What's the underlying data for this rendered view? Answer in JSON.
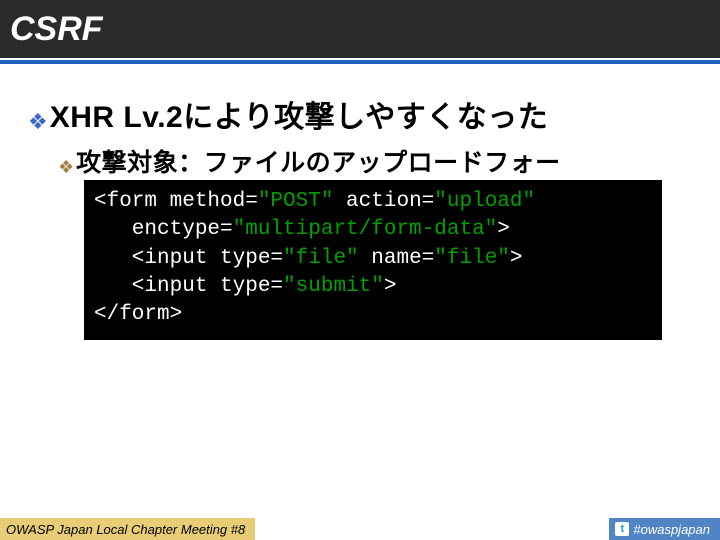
{
  "header": {
    "title": "CSRF"
  },
  "content": {
    "heading": "XHR Lv.2により攻撃しやすくなった",
    "subheading": "攻撃対象：ファイルのアップロードフォー",
    "code": {
      "l1a": "<form method=",
      "l1b": "\"POST\"",
      "l1c": " action=",
      "l1d": "\"upload\"",
      "l2a": "   enctype=",
      "l2b": "\"multipart/form-data\"",
      "l2c": ">",
      "l3a": "   <input type=",
      "l3b": "\"file\"",
      "l3c": " name=",
      "l3d": "\"file\"",
      "l3e": ">",
      "l4a": "   <input type=",
      "l4b": "\"submit\"",
      "l4c": ">",
      "l5": "</form>"
    }
  },
  "footer": {
    "left": "OWASP Japan Local Chapter Meeting #8",
    "hashtag": "#owaspjapan"
  }
}
